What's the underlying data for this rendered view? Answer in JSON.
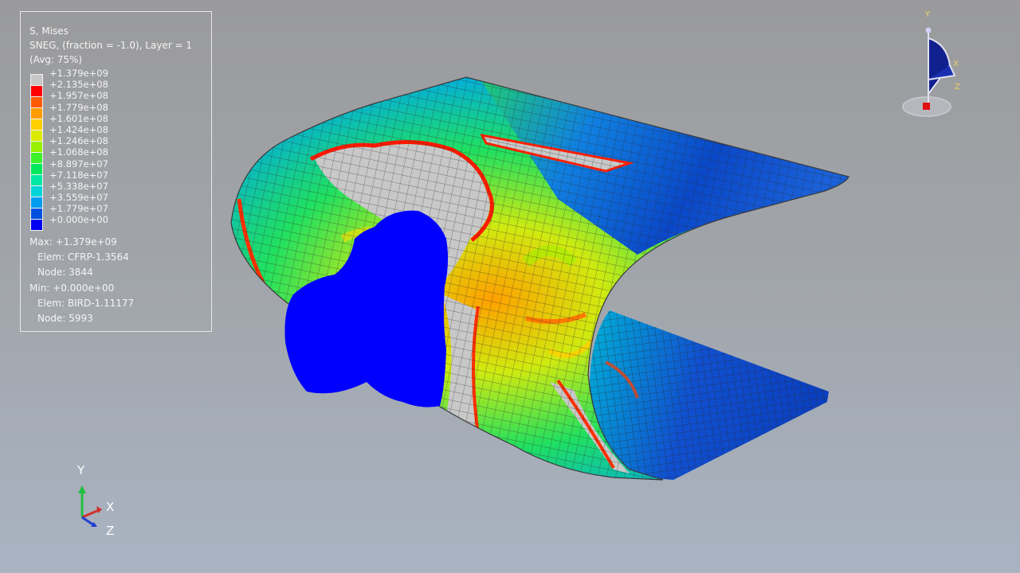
{
  "legend": {
    "title": "S, Mises",
    "subtitle": "SNEG, (fraction = -1.0), Layer = 1",
    "averaging": "(Avg: 75%)",
    "bands": [
      {
        "label": "+1.379e+09",
        "color": "#c8c8c8"
      },
      {
        "label": "+2.135e+08",
        "color": "#ff0000"
      },
      {
        "label": "+1.957e+08",
        "color": "#ff5a00"
      },
      {
        "label": "+1.779e+08",
        "color": "#ff9c00"
      },
      {
        "label": "+1.601e+08",
        "color": "#ffcf00"
      },
      {
        "label": "+1.424e+08",
        "color": "#dcea00"
      },
      {
        "label": "+1.246e+08",
        "color": "#96f000"
      },
      {
        "label": "+1.068e+08",
        "color": "#3cf02c"
      },
      {
        "label": "+8.897e+07",
        "color": "#00e85c"
      },
      {
        "label": "+7.118e+07",
        "color": "#00e8a4"
      },
      {
        "label": "+5.338e+07",
        "color": "#00d4d8"
      },
      {
        "label": "+3.559e+07",
        "color": "#009cf0"
      },
      {
        "label": "+1.779e+07",
        "color": "#0050e0"
      }
    ],
    "bottom_label": "+0.000e+00",
    "bottom_color": "#0000f0",
    "max": {
      "value": "Max: +1.379e+09",
      "elem": "Elem: CFRP-1.3564",
      "node": "Node: 3844"
    },
    "min": {
      "value": "Min: +0.000e+00",
      "elem": "Elem: BIRD-1.11177",
      "node": "Node: 5993"
    }
  },
  "triad": {
    "y": "Y",
    "x": "X",
    "z": "Z"
  },
  "view_cube": {
    "y": "Y",
    "x": "X",
    "z": "Z"
  },
  "colors": {
    "mesh": "#303030",
    "bird": "#0000ff",
    "unstressed": "#c8c8c8"
  }
}
